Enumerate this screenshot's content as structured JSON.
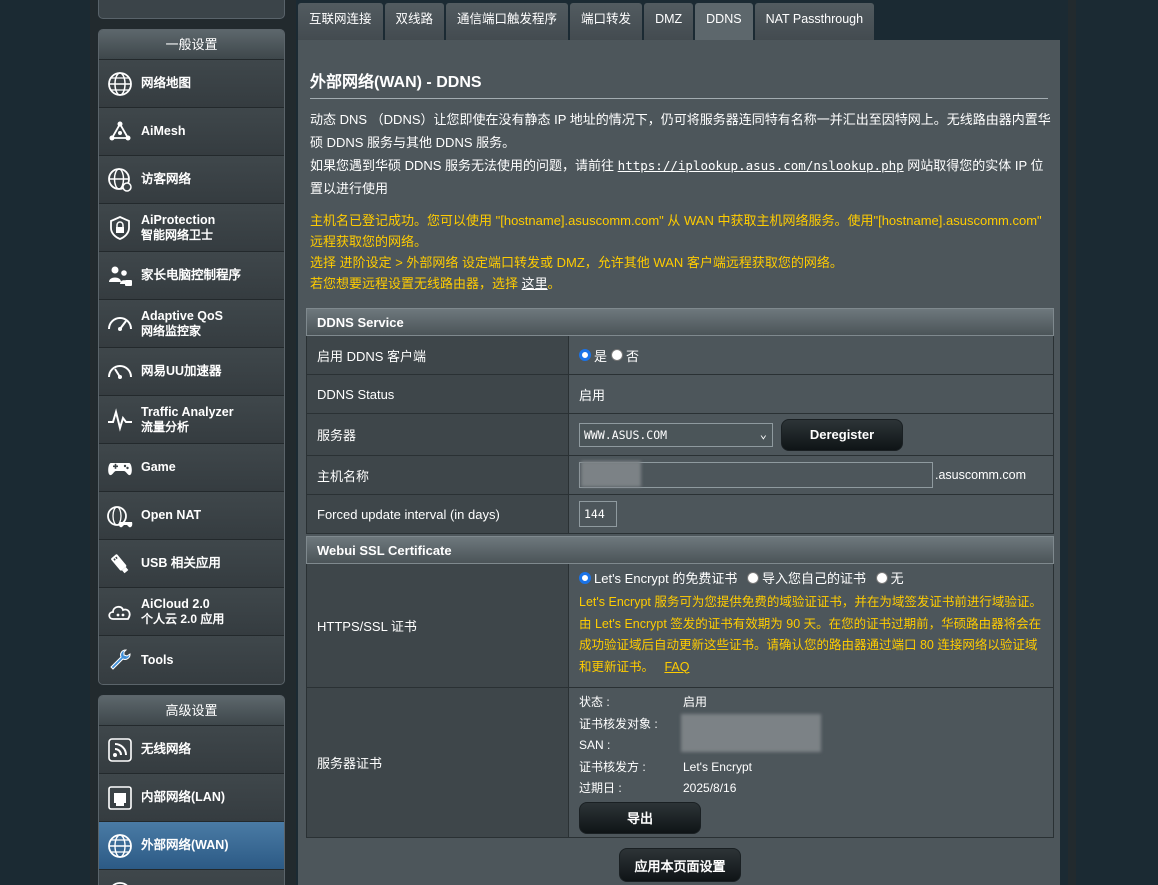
{
  "sidebar": {
    "general_header": "一般设置",
    "advanced_header": "高级设置",
    "general_items": [
      {
        "label": "网络地图",
        "sub": "",
        "icon": "network-map-icon"
      },
      {
        "label": "AiMesh",
        "sub": "",
        "icon": "aimesh-icon"
      },
      {
        "label": "访客网络",
        "sub": "",
        "icon": "guest-network-icon"
      },
      {
        "label": "AiProtection",
        "sub": "智能网络卫士",
        "icon": "shield-lock-icon"
      },
      {
        "label": "家长电脑控制程序",
        "sub": "",
        "icon": "parental-control-icon"
      },
      {
        "label": "Adaptive QoS",
        "sub": "网络监控家",
        "icon": "speedometer-icon"
      },
      {
        "label": "网易UU加速器",
        "sub": "",
        "icon": "uu-booster-icon"
      },
      {
        "label": "Traffic Analyzer",
        "sub": "流量分析",
        "icon": "traffic-analyzer-icon"
      },
      {
        "label": "Game",
        "sub": "",
        "icon": "gamepad-icon"
      },
      {
        "label": "Open NAT",
        "sub": "",
        "icon": "open-nat-icon"
      },
      {
        "label": "USB 相关应用",
        "sub": "",
        "icon": "usb-icon"
      },
      {
        "label": "AiCloud 2.0",
        "sub": "个人云 2.0 应用",
        "icon": "cloud-icon"
      },
      {
        "label": "Tools",
        "sub": "",
        "icon": "wrench-icon"
      }
    ],
    "advanced_items": [
      {
        "label": "无线网络",
        "icon": "wifi-icon"
      },
      {
        "label": "内部网络(LAN)",
        "icon": "lan-icon"
      },
      {
        "label": "外部网络(WAN)",
        "icon": "globe-icon"
      }
    ]
  },
  "tabs": [
    "互联网连接",
    "双线路",
    "通信端口触发程序",
    "端口转发",
    "DMZ",
    "DDNS",
    "NAT Passthrough"
  ],
  "active_tab": "DDNS",
  "page_title": "外部网络(WAN) - DDNS",
  "description": {
    "line1": "动态 DNS （DDNS）让您即使在没有静态 IP 地址的情况下，仍可将服务器连同特有名称一并汇出至因特网上。无线路由器内置华硕 DDNS 服务与其他 DDNS 服务。",
    "line2_prefix": "如果您遇到华硕 DDNS 服务无法使用的问题，请前往 ",
    "line2_link": "https://iplookup.asus.com/nslookup.php",
    "line2_suffix": " 网站取得您的实体 IP 位置以进行使用"
  },
  "notice": {
    "line1": "主机名已登记成功。您可以使用 \"[hostname].asuscomm.com\" 从 WAN 中获取主机网络服务。使用\"[hostname].asuscomm.com\" 远程获取您的网络。",
    "line2": "选择 进阶设定 > 外部网络 设定端口转发或 DMZ，允许其他 WAN 客户端远程获取您的网络。",
    "line3_prefix": "若您想要远程设置无线路由器，选择 ",
    "line3_link": "这里",
    "line3_suffix": "。"
  },
  "ddns_service": {
    "header": "DDNS Service",
    "enable_label": "启用 DDNS 客户端",
    "enable_yes": "是",
    "enable_no": "否",
    "status_label": "DDNS Status",
    "status_value": "启用",
    "server_label": "服务器",
    "server_value": "WWW.ASUS.COM",
    "deregister_button": "Deregister",
    "hostname_label": "主机名称",
    "hostname_suffix": ".asuscomm.com",
    "interval_label": "Forced update interval (in days)",
    "interval_value": "144"
  },
  "ssl": {
    "header": "Webui SSL Certificate",
    "https_label": "HTTPS/SSL 证书",
    "option1": "Let's Encrypt 的免费证书",
    "option2": "导入您自己的证书",
    "option3": "无",
    "note": "Let's Encrypt 服务可为您提供免费的域验证证书，并在为域签发证书前进行域验证。由 Let's Encrypt 签发的证书有效期为 90 天。在您的证书过期前，华硕路由器将会在成功验证域后自动更新这些证书。请确认您的路由器通过端口 80 连接网络以验证域和更新证书。",
    "faq": "FAQ",
    "cert_label": "服务器证书",
    "status_key": "状态 :",
    "status_val": "启用",
    "issued_to_key": "证书核发对象 :",
    "san_key": "SAN :",
    "issuer_key": "证书核发方 :",
    "issuer_val": "Let's Encrypt",
    "expiry_key": "过期日 :",
    "expiry_val": "2025/8/16",
    "export_button": "导出"
  },
  "apply_button": "应用本页面设置",
  "colors": {
    "accent": "#ffcc00",
    "active_nav": "#2c5a85",
    "panel": "#4d565b"
  }
}
